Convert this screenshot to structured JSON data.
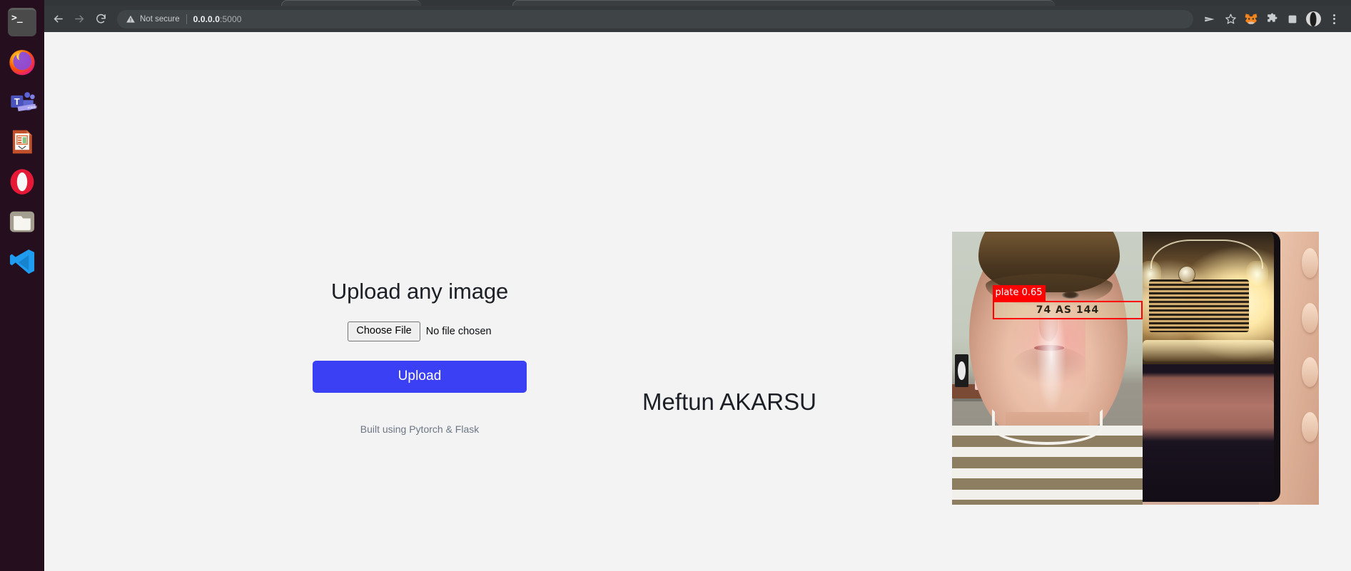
{
  "dock": {
    "items": [
      {
        "name": "terminal",
        "label": "Terminal",
        "glyph": ">_"
      },
      {
        "name": "firefox",
        "label": "Firefox",
        "glyph": ""
      },
      {
        "name": "teams",
        "label": "Microsoft Teams (Preview)",
        "glyph": "T",
        "badge": "PREVIEW"
      },
      {
        "name": "impress",
        "label": "LibreOffice Impress",
        "glyph": ""
      },
      {
        "name": "opera",
        "label": "Opera",
        "glyph": "O"
      },
      {
        "name": "files",
        "label": "Files",
        "glyph": ""
      },
      {
        "name": "vscode",
        "label": "Visual Studio Code",
        "glyph": ""
      }
    ]
  },
  "browser": {
    "back_tooltip": "Back",
    "forward_tooltip": "Forward",
    "reload_tooltip": "Reload",
    "security_label": "Not secure",
    "url_host": "0.0.0.0",
    "url_port": ":5000",
    "actions": [
      {
        "name": "share-icon",
        "label": "Share"
      },
      {
        "name": "bookmark-star-icon",
        "label": "Bookmark this tab"
      },
      {
        "name": "metamask-extension-icon",
        "label": "MetaMask"
      },
      {
        "name": "extensions-puzzle-icon",
        "label": "Extensions"
      },
      {
        "name": "side-panel-icon",
        "label": "Side panel"
      },
      {
        "name": "profile-avatar",
        "label": "Profile"
      },
      {
        "name": "chrome-menu-icon",
        "label": "Customize and control"
      }
    ]
  },
  "page": {
    "heading": "Upload any image",
    "choose_file_label": "Choose File",
    "no_file_label": "No file chosen",
    "upload_label": "Upload",
    "footer": "Built using Pytorch & Flask",
    "author_name": "Meftun AKARSU",
    "result": {
      "alt": "Webcam photo of a person holding a phone displaying a car, with license plate detection",
      "detection_label": "plate  0.65",
      "detection_class": "plate",
      "detection_confidence": "0.65",
      "plate_text": "74 AS 144",
      "box_color": "#ff0000"
    }
  },
  "colors": {
    "page_background": "#f3f3f3",
    "upload_button": "#3b40f5",
    "dock_background": "#250f1e",
    "toolbar_background": "#35393c",
    "omnibox_background": "#3f4447",
    "footer_text": "#6c7684",
    "detection_red": "#ff0000"
  }
}
